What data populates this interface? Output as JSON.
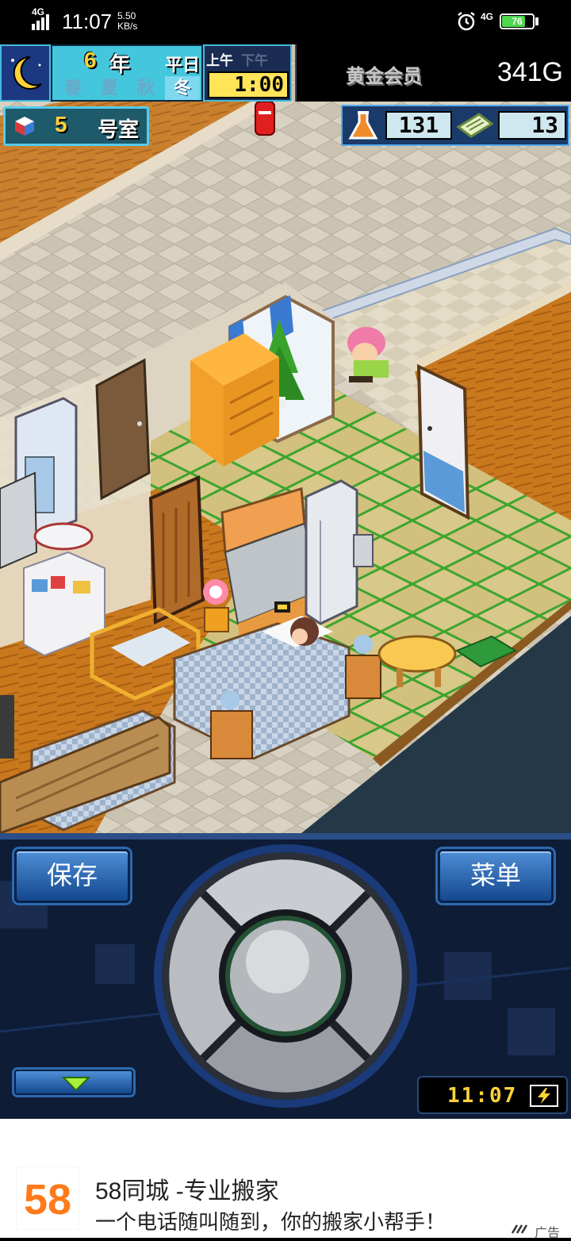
{
  "status_bar": {
    "network_left": "4G",
    "time": "11:07",
    "speed_value": "5.50",
    "speed_unit": "KB/s",
    "network_right": "4G",
    "battery": "76",
    "battery_level": 0.76
  },
  "hud": {
    "year_number": "6",
    "year_label": "年",
    "day_type": "平日",
    "seasons": [
      "春",
      "夏",
      "秋",
      "冬"
    ],
    "active_season": "冬",
    "am_label": "上午",
    "pm_label": "下午",
    "time": "1:00",
    "membership_label": "黄金会员",
    "money": "341G",
    "room_number": "5",
    "room_label": "号室",
    "research_points": "131",
    "tickets": "13"
  },
  "controls": {
    "save_label": "保存",
    "menu_label": "菜单",
    "clock": "11:07"
  },
  "ad": {
    "logo_text": "58",
    "title": "58同城 -专业搬家",
    "description": "一个电话随叫随到，你的搬家小帮手！",
    "tag": "广告"
  },
  "colors": {
    "hud_cyan": "#44c6dd",
    "clock_yellow": "#ffe45a",
    "gold_text": "#ffd23a",
    "button_blue": "#2c6ab0",
    "ad_logo_orange": "#ff7a1a",
    "ad_logo_blue": "#1a9be8"
  },
  "icons": [
    "moon-icon",
    "room-cube-icon",
    "flask-icon",
    "ticket-icon",
    "alarm-icon",
    "down-arrow-icon",
    "bolt-icon"
  ]
}
